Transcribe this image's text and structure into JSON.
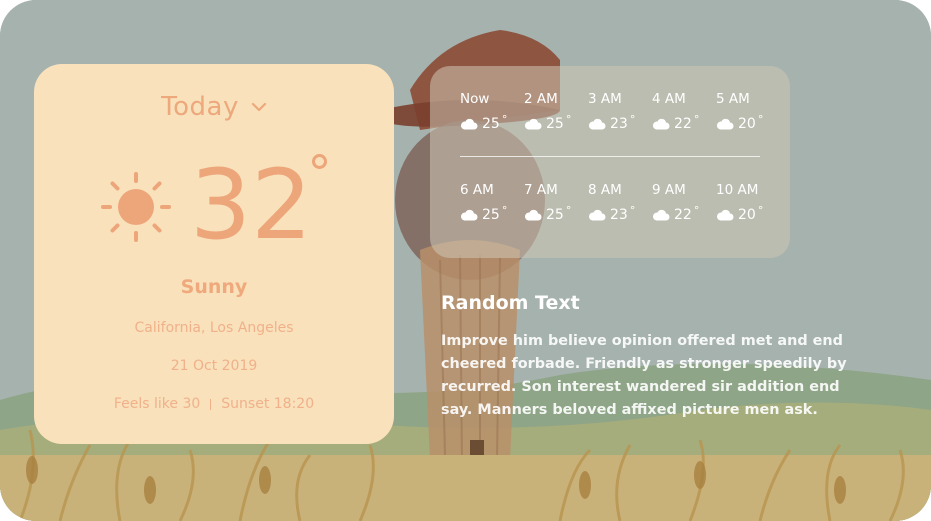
{
  "colors": {
    "card_bg": "#f9e1bb",
    "card_accent": "#eda57a",
    "glass_bg": "rgba(205,198,180,0.55)",
    "text_light": "#ffffff"
  },
  "today": {
    "title": "Today",
    "condition_icon": "sun-icon",
    "temperature": "32",
    "condition": "Sunny",
    "location": "California, Los Angeles",
    "date": "21 Oct 2019",
    "feels_like": "Feels like 30",
    "sunset": "Sunset 18:20"
  },
  "hourly": {
    "row1": [
      {
        "time": "Now",
        "temp": "25",
        "icon": "cloud-icon"
      },
      {
        "time": "2 AM",
        "temp": "25",
        "icon": "cloud-icon"
      },
      {
        "time": "3 AM",
        "temp": "23",
        "icon": "cloud-icon"
      },
      {
        "time": "4 AM",
        "temp": "22",
        "icon": "cloud-icon"
      },
      {
        "time": "5 AM",
        "temp": "20",
        "icon": "cloud-icon"
      }
    ],
    "row2": [
      {
        "time": "6 AM",
        "temp": "25",
        "icon": "cloud-icon"
      },
      {
        "time": "7 AM",
        "temp": "25",
        "icon": "cloud-icon"
      },
      {
        "time": "8 AM",
        "temp": "23",
        "icon": "cloud-icon"
      },
      {
        "time": "9 AM",
        "temp": "22",
        "icon": "cloud-icon"
      },
      {
        "time": "10 AM",
        "temp": "20",
        "icon": "cloud-icon"
      }
    ]
  },
  "random": {
    "title": "Random Text",
    "body": "Improve him believe opinion offered met and  end cheered forbade. Friendly as stronger speedily by recurred. Son interest wandered sir addition end say. Manners beloved affixed  picture men ask."
  }
}
